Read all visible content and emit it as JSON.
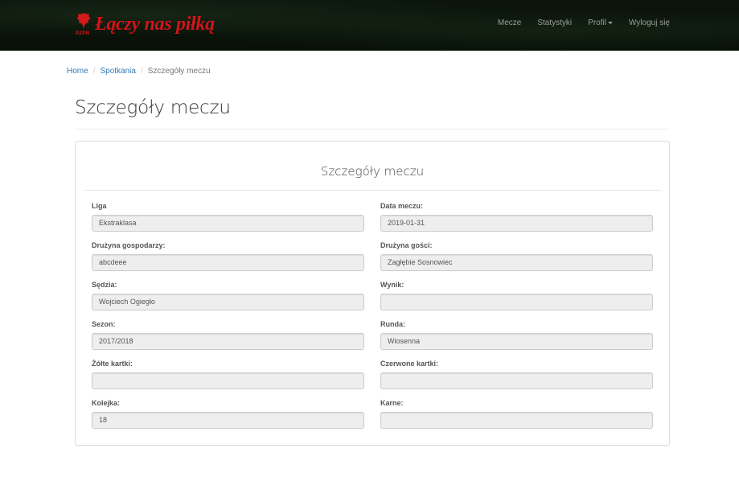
{
  "brand": {
    "name": "Łączy nas piłką",
    "emblem_text": "PZPN",
    "color": "#d0161a"
  },
  "nav": {
    "items": [
      {
        "label": "Mecze"
      },
      {
        "label": "Statystyki"
      },
      {
        "label": "Profil",
        "dropdown": true
      },
      {
        "label": "Wyloguj się"
      }
    ]
  },
  "breadcrumb": {
    "items": [
      "Home",
      "Spotkania"
    ],
    "active": "Szczegóły meczu"
  },
  "page_title": "Szczegóły meczu",
  "panel": {
    "title": "Szczegóły meczu",
    "fields": {
      "liga": {
        "label": "Liga",
        "value": "Ekstraklasa"
      },
      "data_meczu": {
        "label": "Data meczu:",
        "value": "2019-01-31"
      },
      "druzyna_gospodarzy": {
        "label": "Drużyna gospodarzy:",
        "value": "abcdeee"
      },
      "druzyna_gosci": {
        "label": "Drużyna gości:",
        "value": "Zagłębie Sosnowiec"
      },
      "sedzia": {
        "label": "Sędzia:",
        "value": "Wojciech Ogiegło"
      },
      "wynik": {
        "label": "Wynik:",
        "value": ""
      },
      "sezon": {
        "label": "Sezon:",
        "value": "2017/2018"
      },
      "runda": {
        "label": "Runda:",
        "value": "Wiosenna"
      },
      "zolte_kartki": {
        "label": "Żółte kartki:",
        "value": ""
      },
      "czerwone_kartki": {
        "label": "Czerwone kartki:",
        "value": ""
      },
      "kolejka": {
        "label": "Kolejka:",
        "value": "18"
      },
      "karne": {
        "label": "Karne:",
        "value": ""
      }
    }
  },
  "colors": {
    "navbar_bg": "#0a130a",
    "link": "#337ab7",
    "nav_text": "#9d9d9d",
    "input_bg": "#eeeeee"
  }
}
